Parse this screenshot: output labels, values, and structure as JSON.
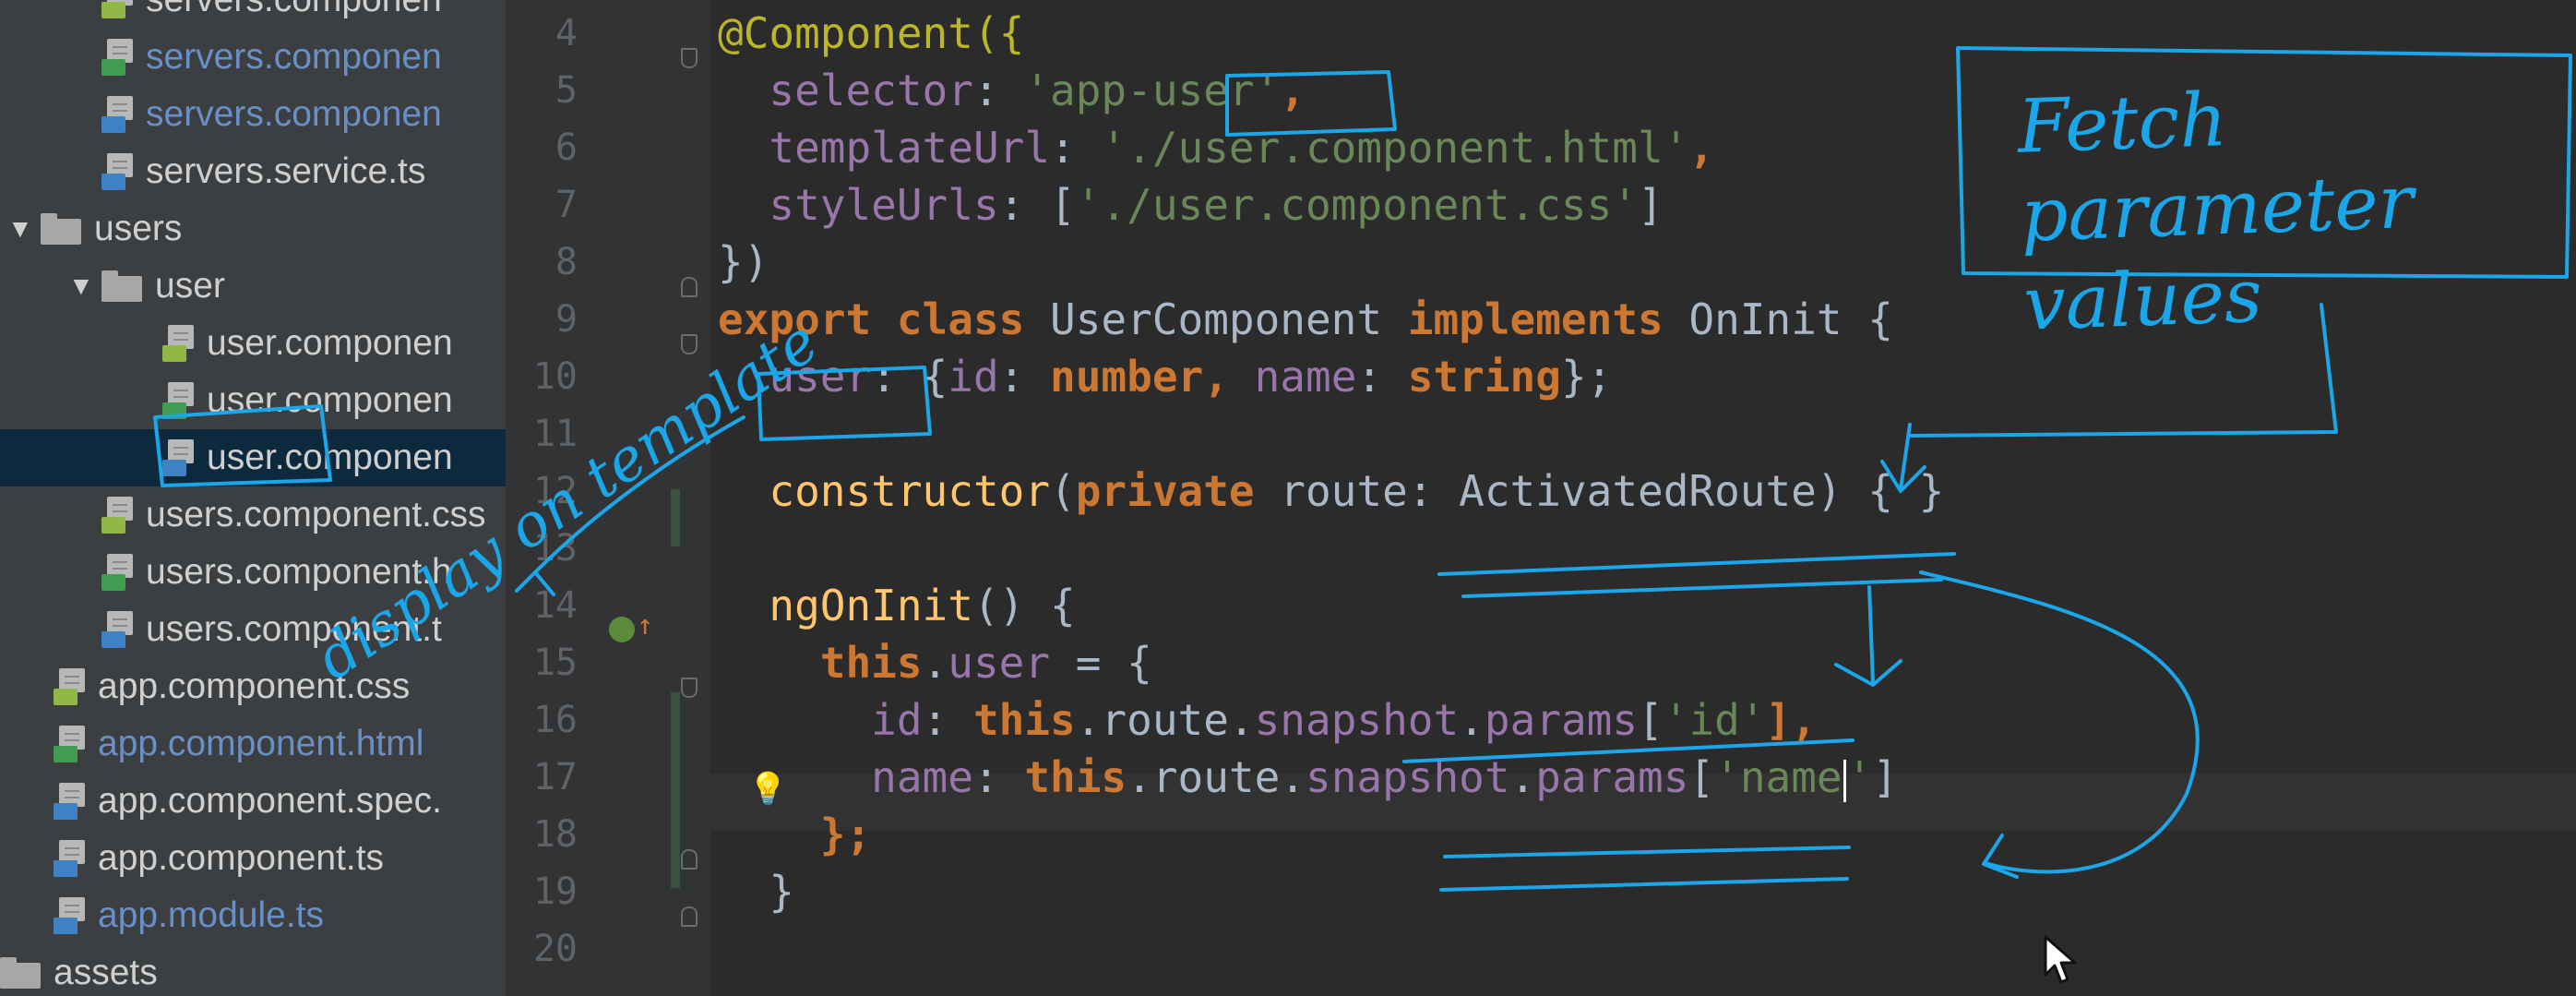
{
  "project_tree": {
    "items": [
      {
        "label": "servers.componen",
        "type": "file",
        "badge": "css",
        "depth": 1,
        "modified": false
      },
      {
        "label": "servers.componen",
        "type": "file",
        "badge": "html",
        "depth": 1,
        "modified": true
      },
      {
        "label": "servers.componen",
        "type": "file",
        "badge": "ts",
        "depth": 1,
        "modified": true
      },
      {
        "label": "servers.service.ts",
        "type": "file",
        "badge": "ts",
        "depth": 1,
        "modified": false
      },
      {
        "label": "users",
        "type": "folder",
        "depth": 0,
        "expanded": true
      },
      {
        "label": "user",
        "type": "folder",
        "depth": 1,
        "expanded": true
      },
      {
        "label": "user.componen",
        "type": "file",
        "badge": "css",
        "depth": 2,
        "modified": false
      },
      {
        "label": "user.componen",
        "type": "file",
        "badge": "html",
        "depth": 2,
        "modified": false
      },
      {
        "label": "user.componen",
        "type": "file",
        "badge": "ts",
        "depth": 2,
        "modified": false,
        "selected": true
      },
      {
        "label": "users.component.css",
        "type": "file",
        "badge": "css",
        "depth": 1,
        "modified": false
      },
      {
        "label": "users.component.h",
        "type": "file",
        "badge": "html",
        "depth": 1,
        "modified": false
      },
      {
        "label": "users.component.t",
        "type": "file",
        "badge": "ts",
        "depth": 1,
        "modified": false
      },
      {
        "label": "app.component.css",
        "type": "file",
        "badge": "css",
        "depth": 0,
        "modified": false
      },
      {
        "label": "app.component.html",
        "type": "file",
        "badge": "html",
        "depth": 0,
        "modified": true
      },
      {
        "label": "app.component.spec.",
        "type": "file",
        "badge": "ts",
        "depth": 0,
        "modified": false
      },
      {
        "label": "app.component.ts",
        "type": "file",
        "badge": "ts",
        "depth": 0,
        "modified": false
      },
      {
        "label": "app.module.ts",
        "type": "file",
        "badge": "ts",
        "depth": 0,
        "modified": true
      },
      {
        "label": "assets",
        "type": "folder",
        "depth": -1,
        "expanded": false
      }
    ]
  },
  "editor": {
    "line_numbers": [
      "4",
      "5",
      "6",
      "7",
      "8",
      "9",
      "10",
      "11",
      "12",
      "13",
      "14",
      "15",
      "16",
      "17",
      "18",
      "19",
      "20"
    ],
    "lines": [
      [
        {
          "t": "@Component({",
          "c": "anno"
        }
      ],
      [
        {
          "t": "  selector",
          "c": "prop"
        },
        {
          "t": ": ",
          "c": "plain"
        },
        {
          "t": "'app-user'",
          "c": "str"
        },
        {
          "t": ",",
          "c": "kw"
        }
      ],
      [
        {
          "t": "  templateUrl",
          "c": "prop"
        },
        {
          "t": ": ",
          "c": "plain"
        },
        {
          "t": "'./user.component.html'",
          "c": "str"
        },
        {
          "t": ",",
          "c": "kw"
        }
      ],
      [
        {
          "t": "  styleUrls",
          "c": "prop"
        },
        {
          "t": ": [",
          "c": "plain"
        },
        {
          "t": "'./user.component.css'",
          "c": "str"
        },
        {
          "t": "]",
          "c": "plain"
        }
      ],
      [
        {
          "t": "})",
          "c": "plain"
        }
      ],
      [
        {
          "t": "export class ",
          "c": "kw"
        },
        {
          "t": "UserComponent ",
          "c": "plain"
        },
        {
          "t": "implements ",
          "c": "kw"
        },
        {
          "t": "OnInit {",
          "c": "plain"
        }
      ],
      [
        {
          "t": "  user",
          "c": "prop"
        },
        {
          "t": ": {",
          "c": "plain"
        },
        {
          "t": "id",
          "c": "prop"
        },
        {
          "t": ": ",
          "c": "plain"
        },
        {
          "t": "number",
          "c": "kw"
        },
        {
          "t": ", ",
          "c": "kw"
        },
        {
          "t": "name",
          "c": "prop"
        },
        {
          "t": ": ",
          "c": "plain"
        },
        {
          "t": "string",
          "c": "kw"
        },
        {
          "t": "};",
          "c": "plain"
        }
      ],
      [],
      [
        {
          "t": "  constructor",
          "c": "fn"
        },
        {
          "t": "(",
          "c": "plain"
        },
        {
          "t": "private ",
          "c": "kw"
        },
        {
          "t": "route: ActivatedRoute) { }",
          "c": "plain"
        }
      ],
      [],
      [
        {
          "t": "  ngOnInit",
          "c": "fn"
        },
        {
          "t": "() {",
          "c": "plain"
        }
      ],
      [
        {
          "t": "    this",
          "c": "kw"
        },
        {
          "t": ".",
          "c": "plain"
        },
        {
          "t": "user",
          "c": "prop"
        },
        {
          "t": " = {",
          "c": "plain"
        }
      ],
      [
        {
          "t": "      id",
          "c": "prop"
        },
        {
          "t": ": ",
          "c": "plain"
        },
        {
          "t": "this",
          "c": "kw"
        },
        {
          "t": ".route.",
          "c": "plain"
        },
        {
          "t": "snapshot",
          "c": "prop"
        },
        {
          "t": ".",
          "c": "plain"
        },
        {
          "t": "params",
          "c": "prop"
        },
        {
          "t": "[",
          "c": "plain"
        },
        {
          "t": "'id'",
          "c": "str"
        },
        {
          "t": "],",
          "c": "kw"
        }
      ],
      [
        {
          "t": "      name",
          "c": "prop"
        },
        {
          "t": ": ",
          "c": "plain"
        },
        {
          "t": "this",
          "c": "kw"
        },
        {
          "t": ".route.",
          "c": "plain"
        },
        {
          "t": "snapshot",
          "c": "prop"
        },
        {
          "t": ".",
          "c": "plain"
        },
        {
          "t": "params",
          "c": "prop"
        },
        {
          "t": "[",
          "c": "plain"
        },
        {
          "t": "'name",
          "c": "str"
        },
        {
          "t": "|",
          "c": "cursor"
        },
        {
          "t": "'",
          "c": "str"
        },
        {
          "t": "]",
          "c": "plain"
        }
      ],
      [
        {
          "t": "    };",
          "c": "kw"
        }
      ],
      [
        {
          "t": "  }",
          "c": "plain"
        }
      ],
      []
    ]
  },
  "annotations": {
    "note_box": "Fetch parameter values",
    "note_left": "display on template"
  },
  "colors": {
    "ink": "#1aa6e8",
    "keyword": "#cc7832",
    "string": "#6a8759",
    "property": "#9876aa",
    "annotation": "#bbb529",
    "function": "#ffc66d"
  }
}
